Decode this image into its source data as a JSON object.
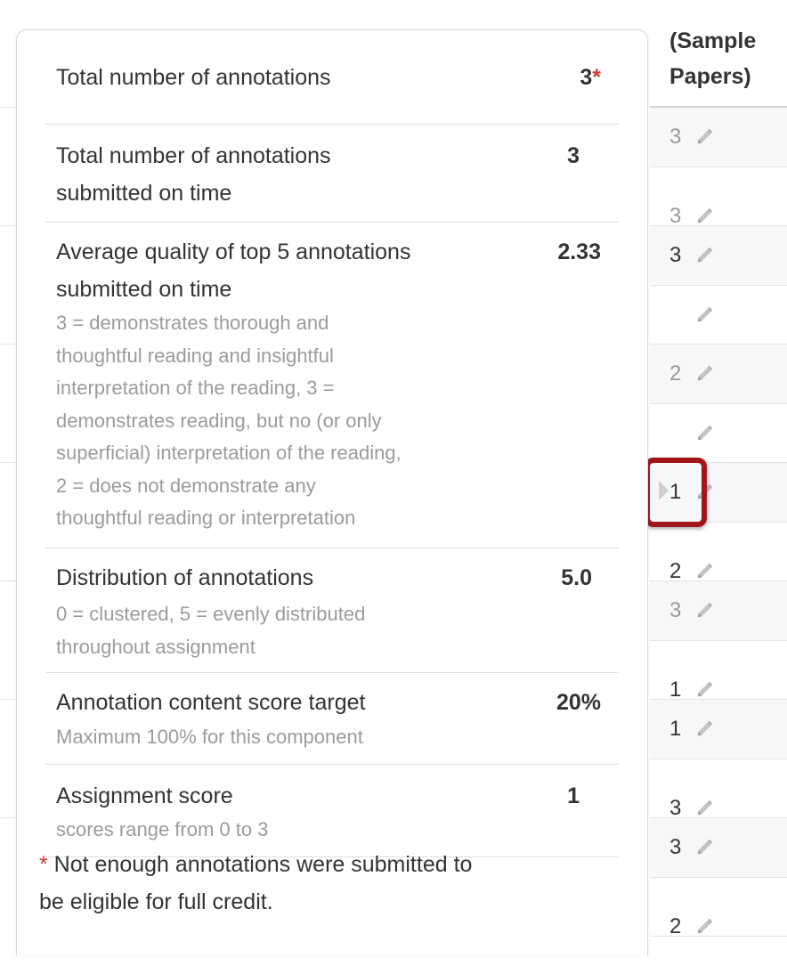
{
  "popover": {
    "rows": [
      {
        "label": "Total number of annotations",
        "value": "3",
        "value_flag": "*"
      },
      {
        "label_lines": [
          "Total number of annotations",
          "submitted on time"
        ],
        "value": "3"
      },
      {
        "label_lines": [
          "Average quality of top 5 annotations",
          "submitted on time"
        ],
        "value": "2.33",
        "description_lines": [
          "3 = demonstrates thorough and",
          "thoughtful reading and insightful",
          "interpretation of the reading, 3 =",
          "demonstrates reading, but no (or only",
          "superficial) interpretation of the reading,",
          "2 = does not demonstrate any",
          "thoughtful reading or interpretation"
        ]
      },
      {
        "label": "Distribution of annotations",
        "value": "5.0",
        "description_lines": [
          "0 = clustered, 5 = evenly distributed",
          "throughout assignment"
        ]
      },
      {
        "label": "Annotation content score target",
        "value": "20%",
        "description_lines": [
          "Maximum 100% for this component"
        ]
      },
      {
        "label": "Assignment score",
        "value": "1",
        "description_lines": [
          "scores range from 0 to 3"
        ]
      }
    ],
    "footnote": {
      "marker": "*",
      "lines": [
        " Not enough annotations were submitted to",
        "be eligible for full credit."
      ]
    }
  },
  "grade_column": {
    "header_lines": [
      "(Sample",
      "Papers)"
    ],
    "cells": [
      {
        "value": "3",
        "style": "muted"
      },
      {
        "value": "3",
        "style": "muted"
      },
      {
        "value": "3",
        "style": "dark"
      },
      {
        "value": "",
        "style": "muted"
      },
      {
        "value": "2",
        "style": "muted"
      },
      {
        "value": "",
        "style": "muted"
      },
      {
        "value": "1",
        "style": "dark"
      },
      {
        "value": "2",
        "style": "dark"
      },
      {
        "value": "3",
        "style": "muted"
      },
      {
        "value": "1",
        "style": "dark"
      },
      {
        "value": "1",
        "style": "dark"
      },
      {
        "value": "3",
        "style": "dark"
      },
      {
        "value": "3",
        "style": "dark"
      },
      {
        "value": "2",
        "style": "dark"
      }
    ],
    "edit_icon": "pencil-icon"
  },
  "colors": {
    "highlight": "#a1161b",
    "asterisk": "#d0392f",
    "muted_text": "#9b9b9b",
    "alt_row": "#f7f7f7"
  }
}
